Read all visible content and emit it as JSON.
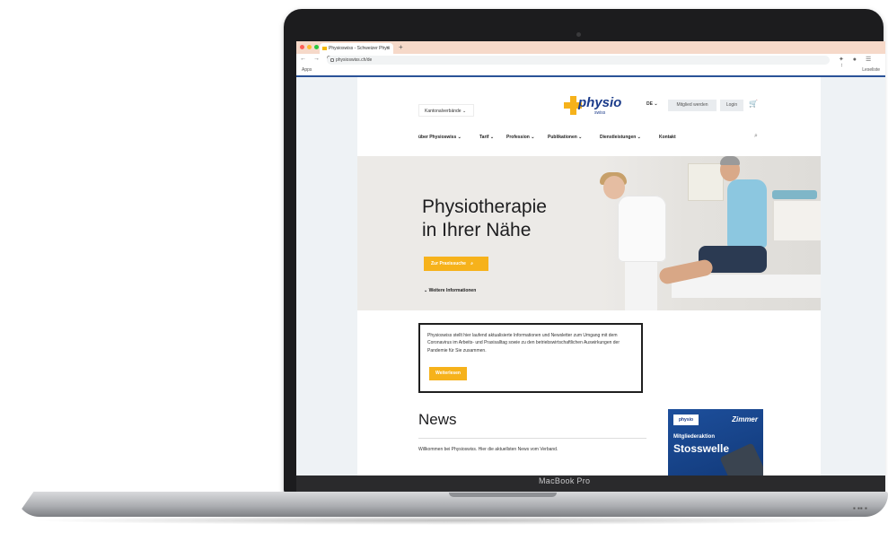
{
  "laptop": {
    "model": "MacBook Pro"
  },
  "browser": {
    "tab_title": "Physioswiss - Schweizer Physi",
    "tab_close": "×",
    "new_tab": "+",
    "url": "physioswiss.ch/de",
    "nav_buttons": "← → C",
    "extensions": "✦ ● ☰ ⋮",
    "bookmarks_apps": "Apps",
    "reading_list": "Leseliste"
  },
  "site": {
    "cantons_dropdown": "Kantonalverbände ⌄",
    "logo": {
      "text": "physio",
      "sub": "swiss"
    },
    "language": "DE ⌄",
    "become_member": "Mitglied werden",
    "login": "Login",
    "nav": {
      "about": "über Physioswiss ⌄",
      "tariff": "Tarif ⌄",
      "profession": "Profession ⌄",
      "publications": "Publikationen ⌄",
      "services": "Dienstleistungen ⌄",
      "contact": "Kontakt"
    },
    "hero": {
      "title_line1": "Physiotherapie",
      "title_line2": "in Ihrer Nähe",
      "cta": "Zur Praxissuche",
      "more_info": "⌄ Weitere Informationen"
    },
    "notice": {
      "text": "Physioswiss stellt hier laufend aktualisierte Informationen und Newsletter zum Umgang mit dem Coronavirus im Arbeits- und Praxisalltag sowie zu den betriebswirtschaftlichen Auswirkungen der Pandemie für Sie zusammen.",
      "button": "Weiterlesen"
    },
    "news": {
      "title": "News",
      "intro": "Willkommen bei Physioswiss. Hier die aktuellsten News vom Verband."
    },
    "ad": {
      "logo": "physio",
      "brand": "Zimmer",
      "line1": "Mitgliederaktion",
      "line2": "Stosswelle"
    }
  },
  "colors": {
    "accent": "#f6b21b",
    "brand_blue": "#1b3b8a"
  }
}
